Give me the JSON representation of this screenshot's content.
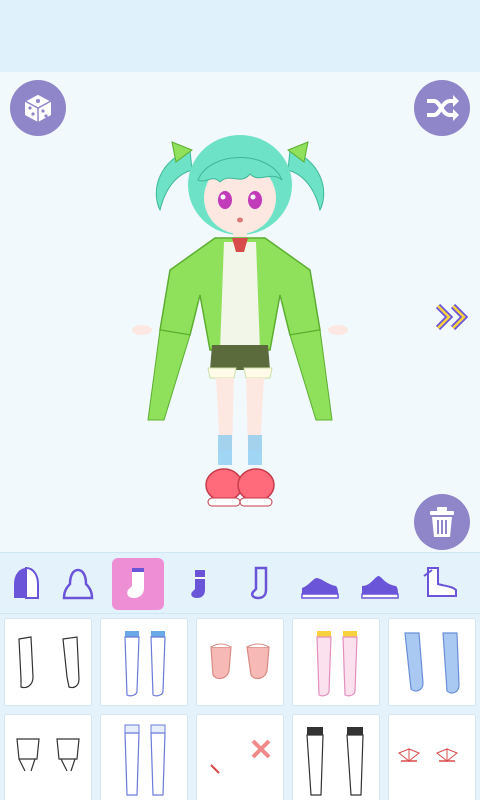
{
  "app": {
    "colors": {
      "button_bg": "#8f85c9",
      "tab_active": "#ee8fd6",
      "tab_icon": "#6a55d8",
      "panel_bg": "#e3f2fb",
      "hair": "#6ee2c6",
      "outfit": "#8fe05a"
    }
  },
  "toolbar": {
    "dice_icon": "dice-icon",
    "shuffle_icon": "shuffle-icon",
    "trash_icon": "trash-icon",
    "next_icon": "double-chevron-right-icon"
  },
  "categories": [
    {
      "icon": "hair-back-icon",
      "active": false
    },
    {
      "icon": "hair-front-icon",
      "active": false
    },
    {
      "icon": "sock-icon",
      "active": true
    },
    {
      "icon": "sock-short-icon",
      "active": false
    },
    {
      "icon": "sock-outline-icon",
      "active": false
    },
    {
      "icon": "shoe-flat-icon",
      "active": false
    },
    {
      "icon": "shoe-heel-icon",
      "active": false
    },
    {
      "icon": "boot-icon",
      "active": false
    }
  ],
  "items": [
    {
      "icon": "plain-white-socks-icon"
    },
    {
      "icon": "blue-band-stockings-icon"
    },
    {
      "icon": "pink-ruffle-socks-icon"
    },
    {
      "icon": "yellow-band-pink-stockings-icon"
    },
    {
      "icon": "blue-knee-socks-icon"
    },
    {
      "icon": "white-ribbon-socks-icon"
    },
    {
      "icon": "lace-stockings-icon"
    },
    {
      "icon": "red-cross-socks-icon"
    },
    {
      "icon": "black-white-stockings-icon"
    },
    {
      "icon": "red-bow-anklets-icon"
    }
  ]
}
